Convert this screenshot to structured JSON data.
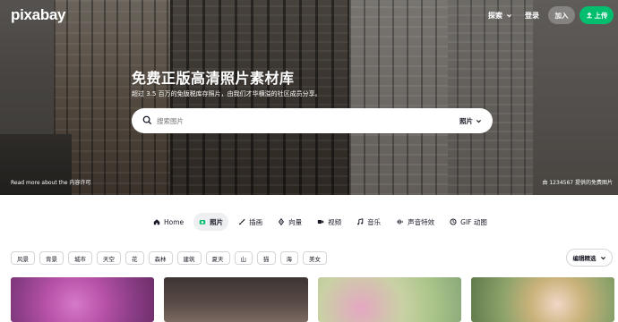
{
  "header": {
    "logo": "pixabay",
    "explore_label": "探索",
    "login_label": "登录",
    "join_label": "加入",
    "upload_label": "上传"
  },
  "hero": {
    "title": "免费正版高清照片素材库",
    "subtitle": "超过 3.5 百万的免版税库存照片，由我们才华横溢的社区成员分享。",
    "search": {
      "placeholder": "搜索图片",
      "type_label": "照片"
    },
    "credit_left": "Read more about the 内容许可",
    "credit_right": "由 1234567 提供的免费图片"
  },
  "tabs": [
    {
      "label": "Home",
      "icon": "home-icon",
      "active": false
    },
    {
      "label": "照片",
      "icon": "camera-icon",
      "active": true
    },
    {
      "label": "插画",
      "icon": "brush-icon",
      "active": false
    },
    {
      "label": "向量",
      "icon": "pen-icon",
      "active": false
    },
    {
      "label": "视频",
      "icon": "video-icon",
      "active": false
    },
    {
      "label": "音乐",
      "icon": "music-icon",
      "active": false
    },
    {
      "label": "声音特效",
      "icon": "sound-icon",
      "active": false
    },
    {
      "label": "GIF 动图",
      "icon": "gif-icon",
      "active": false
    }
  ],
  "chips": [
    "风景",
    "背景",
    "城市",
    "天空",
    "花",
    "森林",
    "建筑",
    "夏天",
    "山",
    "猫",
    "海",
    "美女"
  ],
  "sort_label": "编辑精选",
  "colors": {
    "accent": "#02be6e",
    "text": "#191b26",
    "chip_border": "#d5d5d8"
  }
}
